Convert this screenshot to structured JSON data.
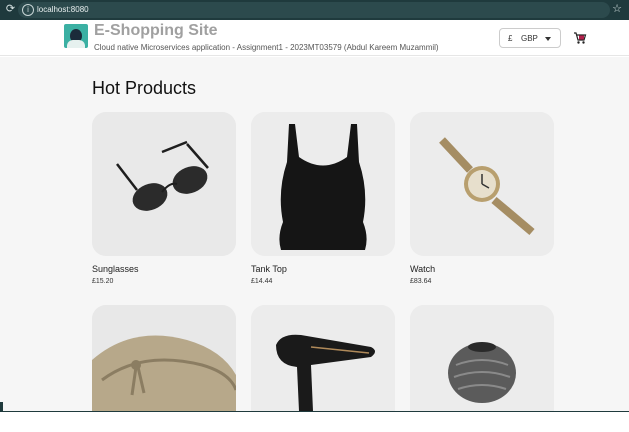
{
  "browser": {
    "url": "localhost:8080"
  },
  "header": {
    "title": "E-Shopping Site",
    "subtitle": "Cloud native Microservices application - Assignment1 - 2023MT03579 (Abdul Kareem Muzammil)",
    "currency": {
      "symbol": "£",
      "code": "GBP"
    }
  },
  "main": {
    "section_title": "Hot Products",
    "products": [
      {
        "name": "Sunglasses",
        "price": "£15.20"
      },
      {
        "name": "Tank Top",
        "price": "£14.44"
      },
      {
        "name": "Watch",
        "price": "£83.64"
      }
    ]
  },
  "icons": {
    "reload": "reload-icon",
    "info": "info-icon",
    "bookmark": "star-icon",
    "cart": "cart-icon"
  },
  "colors": {
    "browser_bar": "#1f3a3d",
    "logo_bg": "#3bb0a3",
    "title": "#a0a0a0",
    "page_bg": "#f6f6f6"
  }
}
